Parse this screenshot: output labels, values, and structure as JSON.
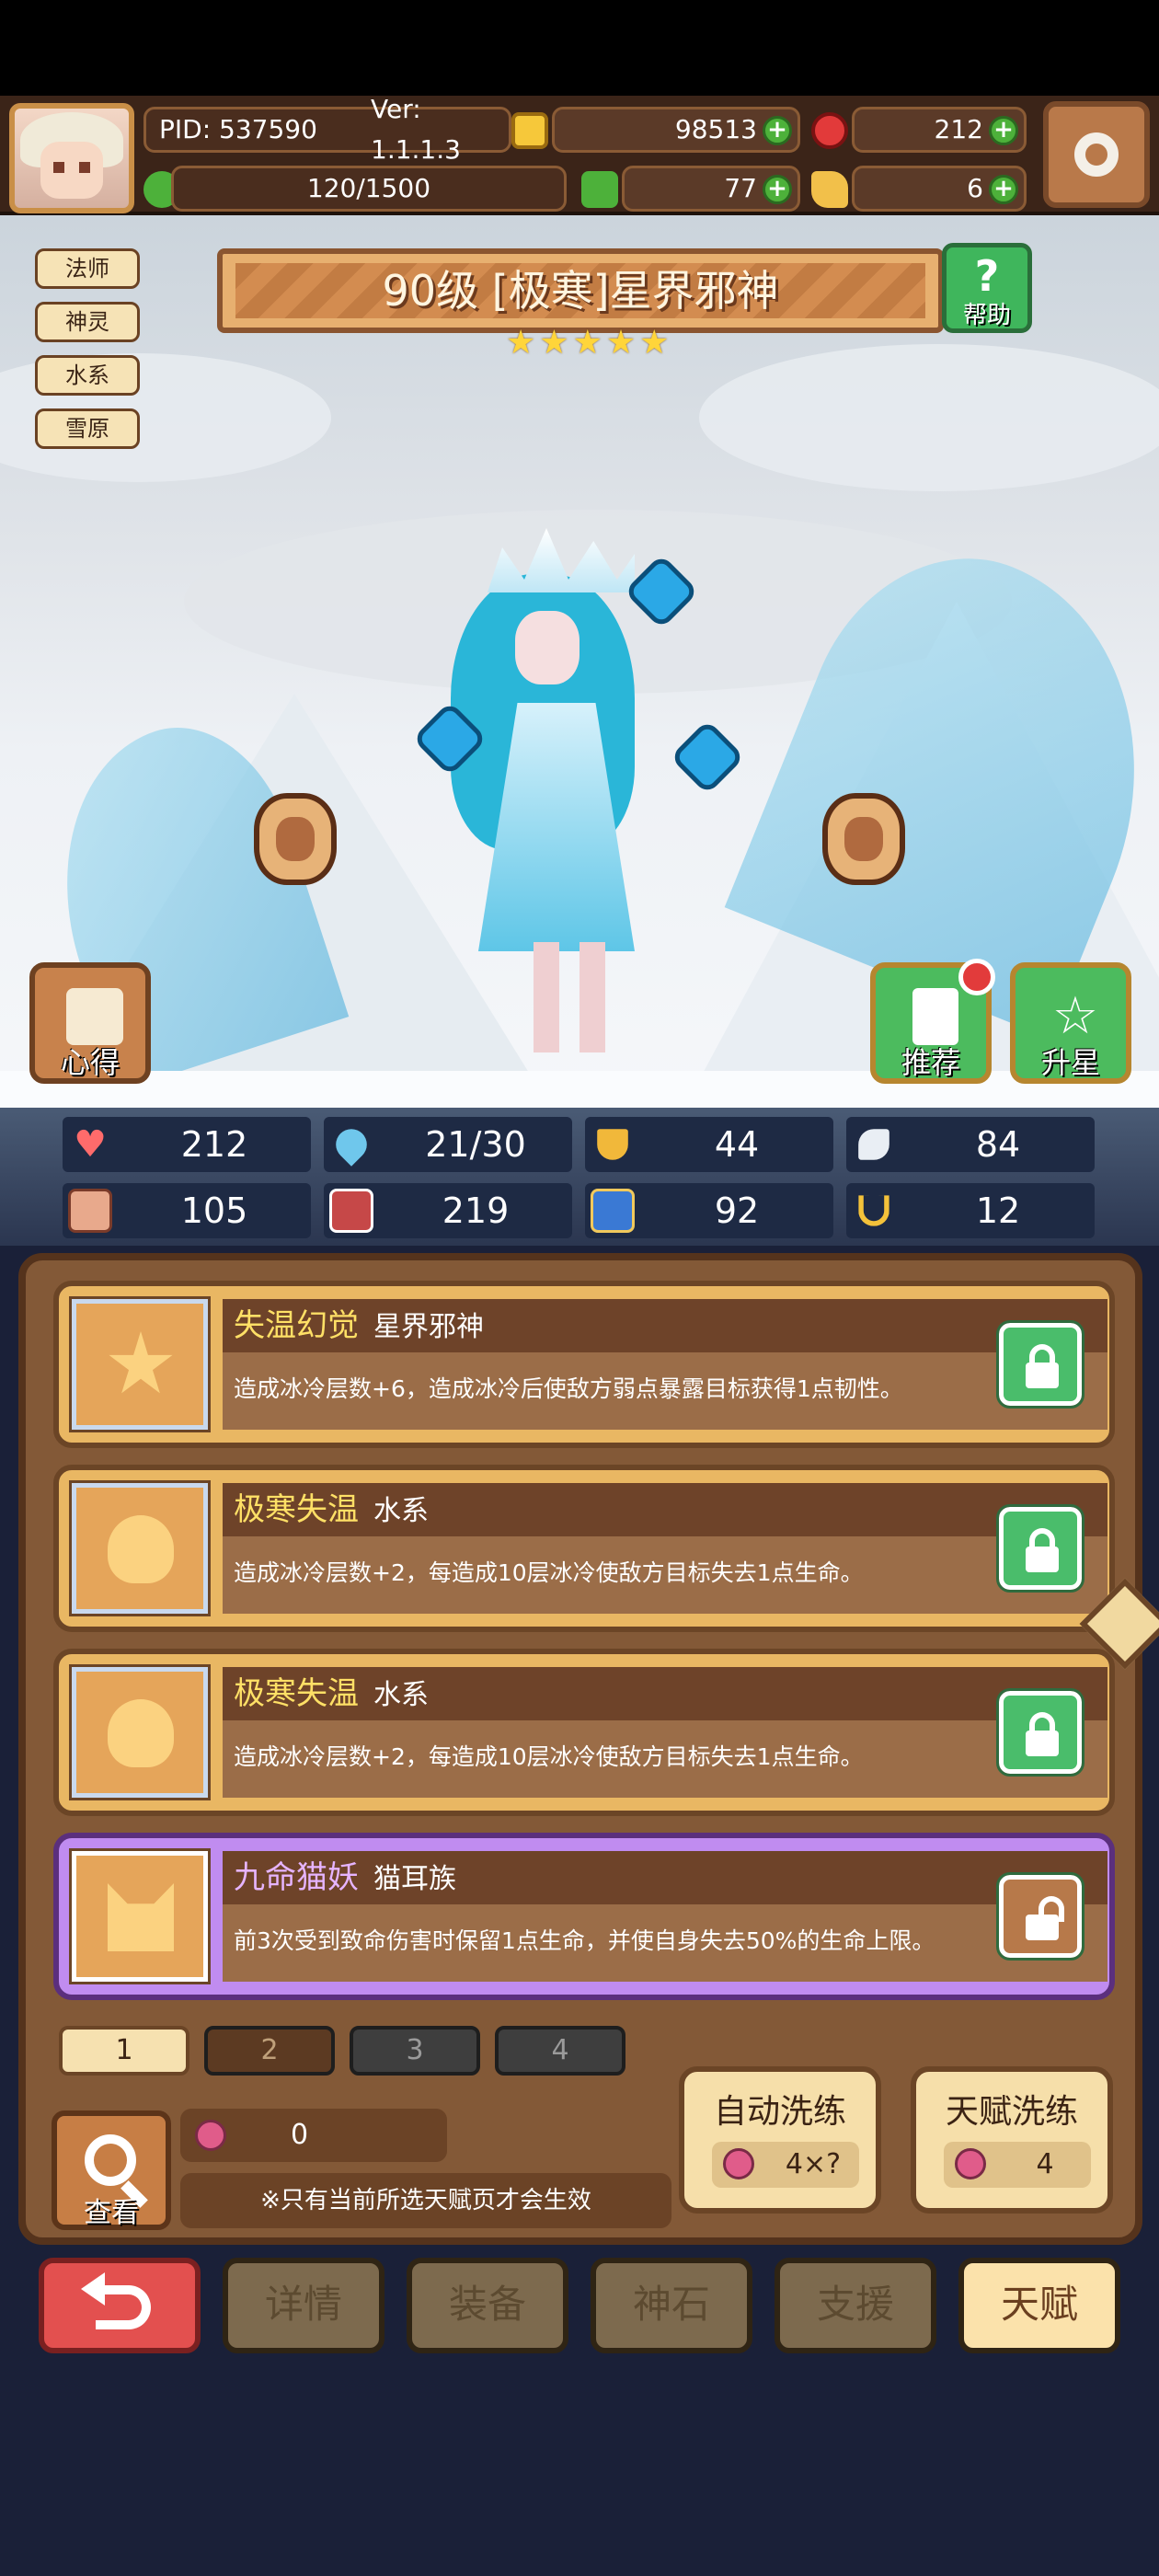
{
  "header": {
    "pid": "PID: 537590",
    "version": "Ver: 1.1.1.3",
    "gold": "98513",
    "gems": "212",
    "stamina": "120/1500",
    "clover": "77",
    "key": "6"
  },
  "tags": [
    "法师",
    "神灵",
    "水系",
    "雪原"
  ],
  "hero": {
    "title": "90级 [极寒]星界邪神",
    "stars": 5,
    "help_label": "帮助"
  },
  "scene_buttons": {
    "insight": "心得",
    "recommend": "推荐",
    "star_up": "升星"
  },
  "stats": [
    {
      "icon": "heart-icon",
      "value": "212"
    },
    {
      "icon": "water-drop-icon",
      "value": "21/30"
    },
    {
      "icon": "shield-icon",
      "value": "44"
    },
    {
      "icon": "wing-icon",
      "value": "84"
    },
    {
      "icon": "fist-icon",
      "value": "105"
    },
    {
      "icon": "book-icon",
      "value": "219"
    },
    {
      "icon": "boot-icon",
      "value": "92"
    },
    {
      "icon": "horseshoe-icon",
      "value": "12"
    }
  ],
  "talents": [
    {
      "name": "失温幻觉",
      "sub": "星界邪神",
      "desc": "造成冰冷层数+6，造成冰冷后使敌方弱点暴露目标获得1点韧性。",
      "locked": true
    },
    {
      "name": "极寒失温",
      "sub": "水系",
      "desc": "造成冰冷层数+2，每造成10层冰冷使敌方目标失去1点生命。",
      "locked": true
    },
    {
      "name": "极寒失温",
      "sub": "水系",
      "desc": "造成冰冷层数+2，每造成10层冰冷使敌方目标失去1点生命。",
      "locked": true
    },
    {
      "name": "九命猫妖",
      "sub": "猫耳族",
      "desc": "前3次受到致命伤害时保留1点生命，并使自身失去50%的生命上限。",
      "locked": false
    }
  ],
  "page_tabs": [
    "1",
    "2",
    "3",
    "4"
  ],
  "bottom": {
    "view_label": "查看",
    "fruit_count": "0",
    "notice": "※只有当前所选天赋页才会生效",
    "auto_wash_label": "自动洗练",
    "auto_wash_cost": "4×?",
    "talent_wash_label": "天赋洗练",
    "talent_wash_cost": "4"
  },
  "nav": {
    "details": "详情",
    "equipment": "装备",
    "divine_stone": "神石",
    "support": "支援",
    "talent": "天赋"
  },
  "colors": {
    "panel_brown": "#835937",
    "accent_gold": "#ffe066",
    "lock_green": "#4abd6b",
    "purple_card": "#c08cf0",
    "back_red": "#e3504f"
  }
}
